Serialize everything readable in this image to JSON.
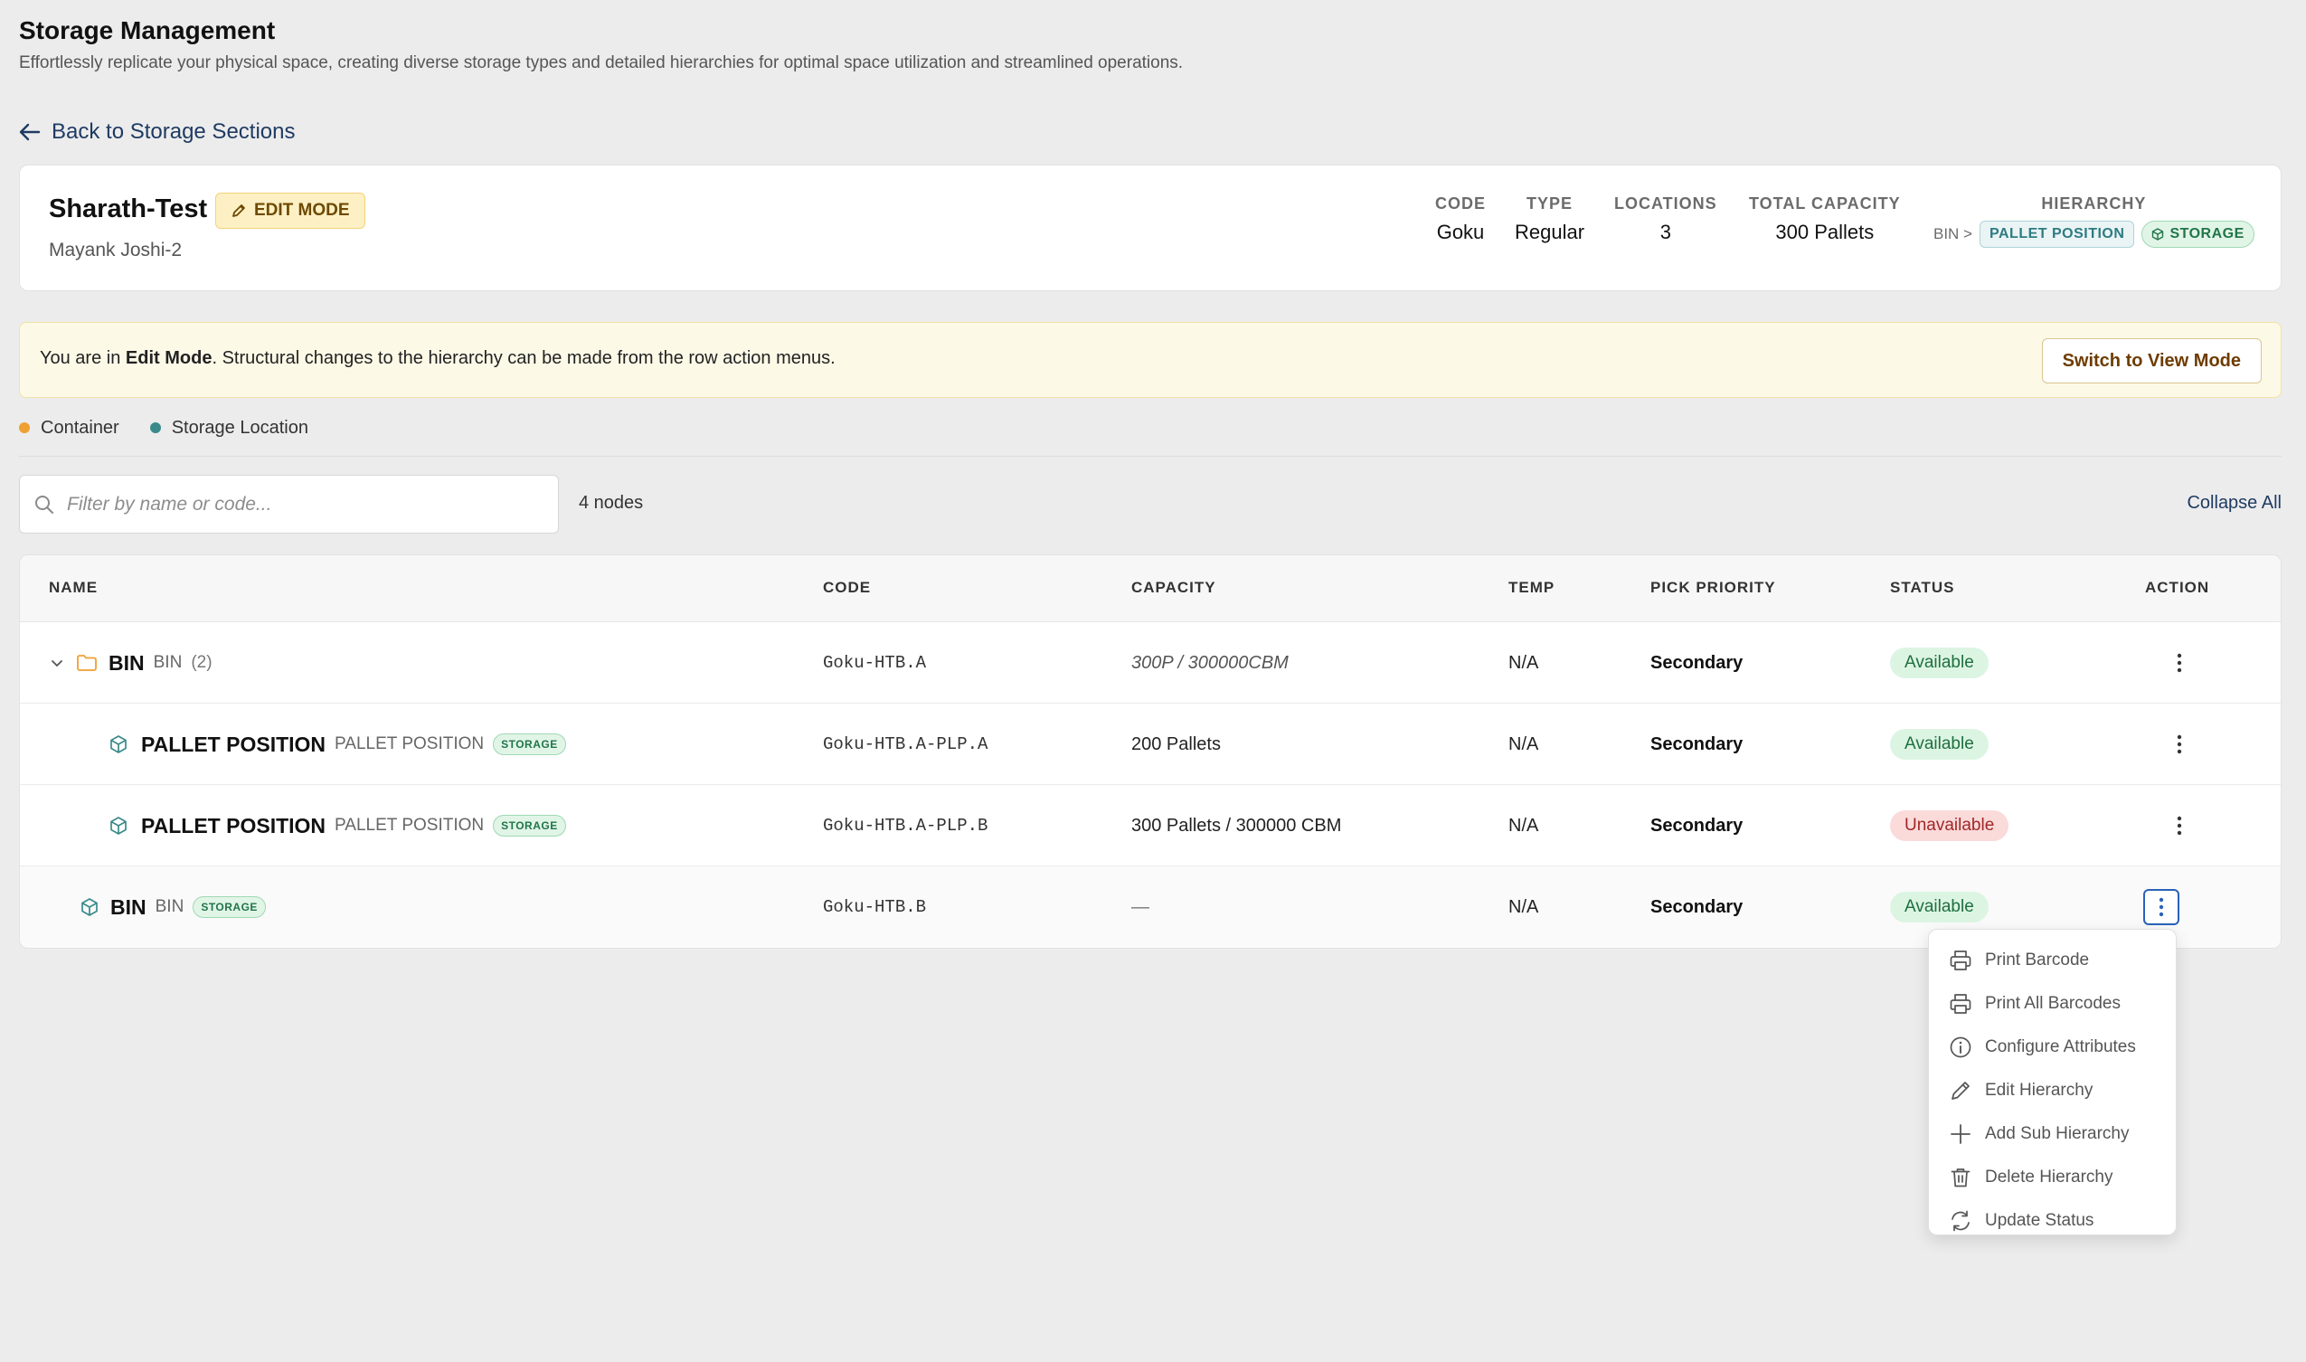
{
  "page": {
    "title": "Storage Management",
    "subtitle": "Effortlessly replicate your physical space, creating diverse storage types and detailed hierarchies for optimal space utilization and streamlined operations."
  },
  "nav": {
    "back_label": "Back to Storage Sections"
  },
  "section": {
    "name": "Sharath-Test",
    "mode_badge": "EDIT MODE",
    "owner": "Mayank Joshi-2",
    "stats": {
      "code_label": "CODE",
      "code": "Goku",
      "type_label": "TYPE",
      "type": "Regular",
      "locations_label": "LOCATIONS",
      "locations": "3",
      "capacity_label": "TOTAL CAPACITY",
      "capacity": "300 Pallets",
      "hierarchy_label": "HIERARCHY",
      "hierarchy_root": "BIN >",
      "hierarchy_child": "PALLET POSITION",
      "hierarchy_storage": "STORAGE"
    }
  },
  "banner": {
    "prefix": "You are in ",
    "mode": "Edit Mode",
    "suffix": ". Structural changes to the hierarchy can be made from the row action menus.",
    "button": "Switch to View Mode"
  },
  "legend": {
    "container": "Container",
    "container_color": "#f0a032",
    "storage": "Storage Location",
    "storage_color": "#3a8a8a"
  },
  "filter": {
    "placeholder": "Filter by name or code...",
    "value": "",
    "node_count": "4 nodes",
    "collapse_all": "Collapse All"
  },
  "table": {
    "headers": {
      "name": "NAME",
      "code": "CODE",
      "capacity": "CAPACITY",
      "temp": "TEMP",
      "pick_priority": "PICK PRIORITY",
      "status": "STATUS",
      "action": "ACTION"
    },
    "rows": [
      {
        "name": "BIN",
        "type": "BIN",
        "count": "(2)",
        "code": "Goku-HTB.A",
        "capacity": "300P / 300000CBM",
        "temp": "N/A",
        "priority": "Secondary",
        "status": "Available"
      },
      {
        "name": "PALLET POSITION",
        "type": "PALLET POSITION",
        "tag": "STORAGE",
        "code": "Goku-HTB.A-PLP.A",
        "capacity": "200 Pallets",
        "temp": "N/A",
        "priority": "Secondary",
        "status": "Available"
      },
      {
        "name": "PALLET POSITION",
        "type": "PALLET POSITION",
        "tag": "STORAGE",
        "code": "Goku-HTB.A-PLP.B",
        "capacity": "300 Pallets / 300000 CBM",
        "temp": "N/A",
        "priority": "Secondary",
        "status": "Unavailable"
      },
      {
        "name": "BIN",
        "type": "BIN",
        "tag": "STORAGE",
        "code": "Goku-HTB.B",
        "capacity": "—",
        "temp": "N/A",
        "priority": "Secondary",
        "status": "Available"
      }
    ]
  },
  "action_menu": {
    "items": [
      "Print Barcode",
      "Print All Barcodes",
      "Configure Attributes",
      "Edit Hierarchy",
      "Add Sub Hierarchy",
      "Delete Hierarchy",
      "Update Status"
    ],
    "icons": [
      "printer-icon",
      "printer-icon",
      "info-icon",
      "pencil-icon",
      "plus-icon",
      "trash-icon",
      "refresh-icon"
    ]
  }
}
